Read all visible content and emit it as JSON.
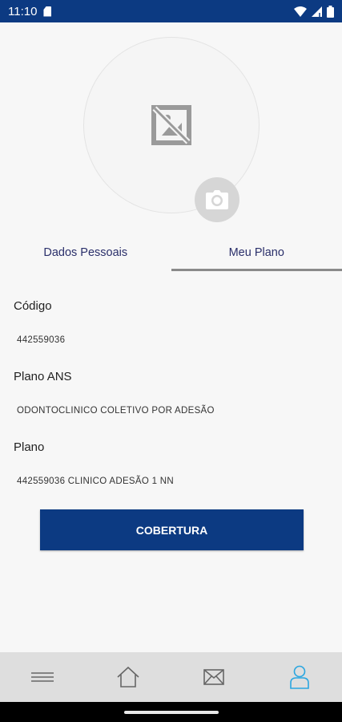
{
  "status_bar": {
    "time": "11:10"
  },
  "tabs": [
    {
      "label": "Dados Pessoais",
      "active": false
    },
    {
      "label": "Meu Plano",
      "active": true
    }
  ],
  "plan": {
    "codigo_label": "Código",
    "codigo_value": "442559036",
    "plano_ans_label": "Plano ANS",
    "plano_ans_value": "ODONTOCLINICO COLETIVO POR ADESÃO",
    "plano_label": "Plano",
    "plano_value": "442559036 CLINICO ADESÃO 1 NN"
  },
  "actions": {
    "cobertura_label": "COBERTURA"
  },
  "bottom_nav": [
    {
      "icon": "menu-icon",
      "active": false
    },
    {
      "icon": "home-icon",
      "active": false
    },
    {
      "icon": "mail-icon",
      "active": false
    },
    {
      "icon": "profile-icon",
      "active": true
    }
  ],
  "colors": {
    "primary": "#0c3a82",
    "tab_text": "#2a2f6a",
    "active_nav": "#2aa6e0",
    "nav_icon": "#666666"
  }
}
